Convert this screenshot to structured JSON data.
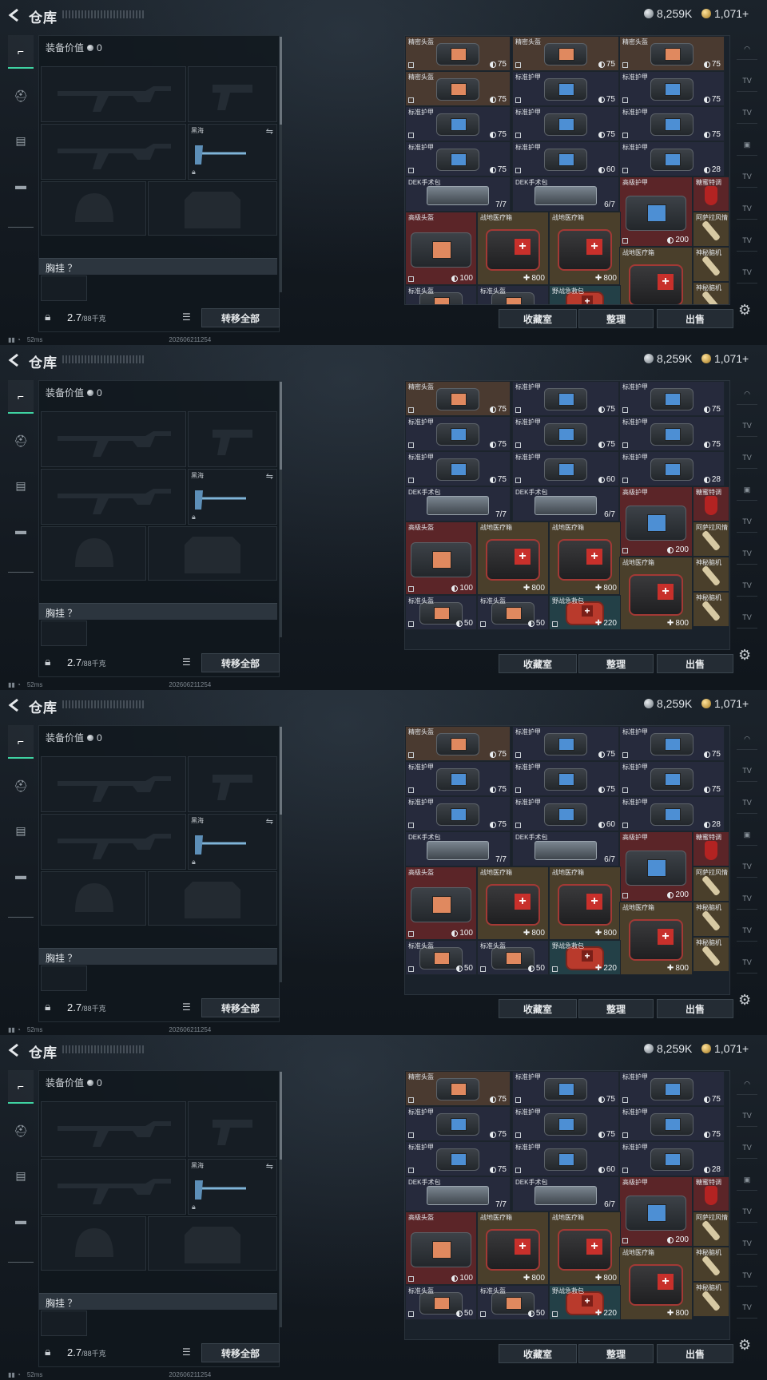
{
  "header": {
    "title": "仓库",
    "silver": "8,259K",
    "gold": "1,071+"
  },
  "equipment": {
    "value_label": "装备价值",
    "value": "0",
    "melee_label": "黑海",
    "chest_label": "胸挂 ？",
    "weight": "2.7",
    "weight_max": "/88千克",
    "transfer_all": "转移全部"
  },
  "status": {
    "ping": "52ms",
    "timestamp": "202606211254"
  },
  "storage_buttons": {
    "favorites": "收藏室",
    "sort": "整理",
    "sell": "出售"
  },
  "frames": [
    {
      "items": [
        {
          "name": "精密头盔",
          "val": "75",
          "kind": "dur",
          "img": "bag",
          "bg": "brown",
          "row": 0,
          "col": 0
        },
        {
          "name": "精密头盔",
          "val": "75",
          "kind": "dur",
          "img": "bag",
          "bg": "brown",
          "row": 0,
          "col": 1
        },
        {
          "name": "精密头盔",
          "val": "75",
          "kind": "dur",
          "img": "bag",
          "bg": "brown",
          "row": 0,
          "col": 2
        },
        {
          "name": "精密头盔",
          "val": "75",
          "kind": "dur",
          "img": "bag",
          "bg": "brown",
          "row": 1,
          "col": 0
        },
        {
          "name": "标准护甲",
          "val": "75",
          "kind": "dur",
          "img": "bag-blue",
          "bg": "purple",
          "row": 1,
          "col": 1
        },
        {
          "name": "标准护甲",
          "val": "75",
          "kind": "dur",
          "img": "bag-blue",
          "bg": "purple",
          "row": 1,
          "col": 2
        },
        {
          "name": "标准护甲",
          "val": "75",
          "kind": "dur",
          "img": "bag-blue",
          "bg": "purple",
          "row": 2,
          "col": 0
        },
        {
          "name": "标准护甲",
          "val": "75",
          "kind": "dur",
          "img": "bag-blue",
          "bg": "purple",
          "row": 2,
          "col": 1
        },
        {
          "name": "标准护甲",
          "val": "75",
          "kind": "dur",
          "img": "bag-blue",
          "bg": "purple",
          "row": 2,
          "col": 2
        },
        {
          "name": "标准护甲",
          "val": "75",
          "kind": "dur",
          "img": "bag-blue",
          "bg": "purple",
          "row": 3,
          "col": 0
        },
        {
          "name": "标准护甲",
          "val": "60",
          "kind": "dur",
          "img": "bag-blue",
          "bg": "purple",
          "row": 3,
          "col": 1
        },
        {
          "name": "标准护甲",
          "val": "28",
          "kind": "dur",
          "img": "bag-blue",
          "bg": "purple",
          "row": 3,
          "col": 2
        },
        {
          "name": "DEK手术包",
          "val": "7/7",
          "kind": "text",
          "img": "case",
          "bg": "purple",
          "row": 4,
          "col": 0
        },
        {
          "name": "DEK手术包",
          "val": "6/7",
          "kind": "text",
          "img": "case",
          "bg": "purple",
          "row": 4,
          "col": 1
        }
      ]
    }
  ],
  "storage_common": {
    "advanced_armor": {
      "name": "高级护甲",
      "val": "200"
    },
    "sugar_drink": {
      "name": "糖蜜特调"
    },
    "wind_drink": {
      "name": "阿萨拉风情"
    },
    "adv_helmet": {
      "name": "高级头盔",
      "val": "100"
    },
    "med_box": {
      "name": "战地医疗箱",
      "val": "800"
    },
    "nerve": {
      "name": "神秘脑机"
    },
    "std_helmet": {
      "name": "标准头盔",
      "val": "50"
    },
    "field_kit": {
      "name": "野战急救包",
      "val": "220"
    }
  },
  "right_rail": [
    "◠",
    "TV",
    "TV",
    "▣",
    "TV",
    "TV",
    "TV",
    "TV"
  ]
}
